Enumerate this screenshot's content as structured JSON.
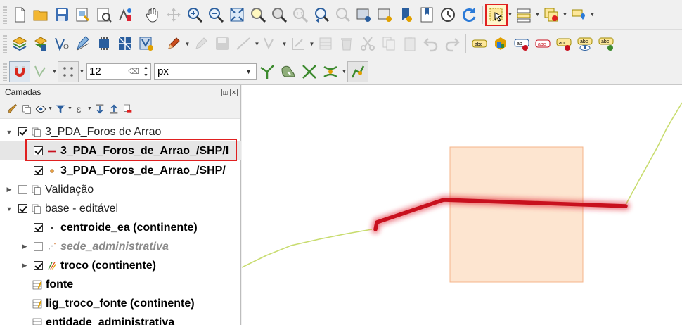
{
  "layers_panel": {
    "title": "Camadas",
    "layers": [
      {
        "label": "3_PDA_Foros de Arrao"
      },
      {
        "label": "3_PDA_Foros_de_Arrao_/SHP/I"
      },
      {
        "label": "3_PDA_Foros_de_Arrao_/SHP/"
      },
      {
        "label": "Validação"
      },
      {
        "label": "base - editável"
      },
      {
        "label": "centroide_ea (continente)"
      },
      {
        "label": "sede_administrativa"
      },
      {
        "label": "troco (continente)"
      },
      {
        "label": "fonte"
      },
      {
        "label": "lig_troco_fonte (continente)"
      },
      {
        "label": "entidade_administrativa"
      }
    ]
  },
  "snapping": {
    "tolerance_value": "12",
    "unit": "px"
  },
  "colors": {
    "highlight_outline": "#e02020",
    "selected_line": "#c8101e",
    "polygon_fill": "#fde0c8",
    "polygon_stroke": "#f5b48a",
    "line_feature": "#c8dc6e",
    "toolbar_bg": "#f0f0f0"
  }
}
